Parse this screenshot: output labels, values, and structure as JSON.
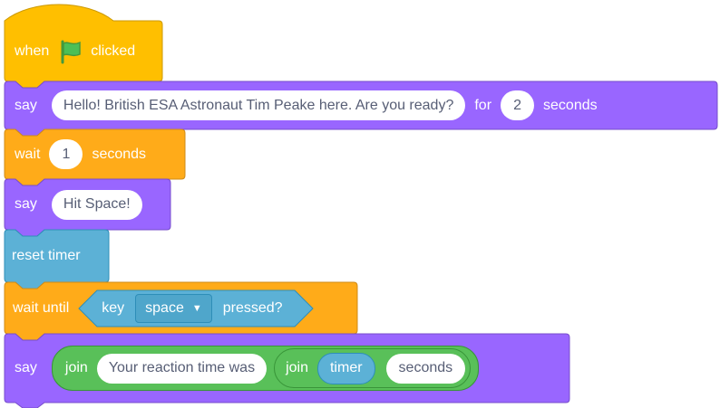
{
  "colors": {
    "events": "#ffbf00",
    "looks": "#9966ff",
    "control": "#ffab19",
    "sensing": "#5cb1d6",
    "operators": "#59c059",
    "flag": "#4cbf56"
  },
  "blocks": {
    "hat": {
      "when": "when",
      "flag_icon": "green-flag-icon",
      "clicked": "clicked"
    },
    "say1": {
      "say": "say",
      "message": "Hello! British ESA Astronaut Tim Peake here. Are you ready?",
      "for": "for",
      "secs": "2",
      "seconds": "seconds"
    },
    "wait1": {
      "wait": "wait",
      "secs": "1",
      "seconds": "seconds"
    },
    "say2": {
      "say": "say",
      "message": "Hit Space!"
    },
    "reset": {
      "label": "reset timer"
    },
    "wait_until": {
      "label": "wait until",
      "key": "key",
      "key_value": "space",
      "pressed": "pressed?"
    },
    "say3": {
      "say": "say",
      "join1": "join",
      "text1": "Your reaction time was",
      "join2": "join",
      "timer": "timer",
      "text2": "seconds"
    }
  }
}
